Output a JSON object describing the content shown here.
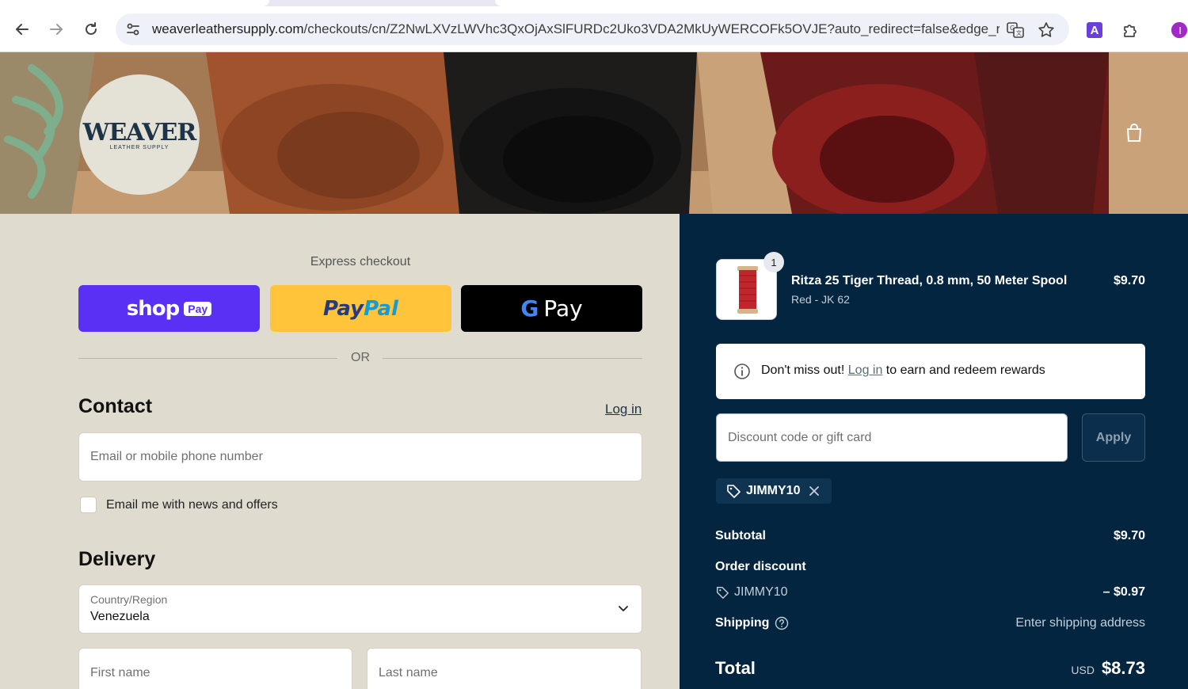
{
  "browser": {
    "url_host": "weaverleathersupply.com",
    "url_path": "/checkouts/cn/Z2NwLXVzLWVhc3QxOjAxSlFURDc2Uko3VDA2MkUyWERCOFk5OVJE?auto_redirect=false&edge_re...",
    "profile_initial": "I",
    "extension_letter": "A"
  },
  "brand": {
    "logo_name": "WEAVER",
    "logo_subtitle": "LEATHER SUPPLY"
  },
  "express": {
    "title": "Express checkout",
    "shop_word": "shop",
    "shop_pill": "Pay",
    "paypal_pay": "Pay",
    "paypal_pal": "Pal",
    "gpay_g": "G",
    "gpay_word": "Pay",
    "or_text": "OR"
  },
  "contact": {
    "heading": "Contact",
    "login_label": "Log in",
    "email_placeholder": "Email or mobile phone number",
    "newsletter_label": "Email me with news and offers"
  },
  "delivery": {
    "heading": "Delivery",
    "country_label": "Country/Region",
    "country_value": "Venezuela",
    "first_name_placeholder": "First name",
    "last_name_placeholder": "Last name"
  },
  "summary": {
    "item": {
      "quantity": "1",
      "title": "Ritza 25 Tiger Thread, 0.8 mm, 50 Meter Spool",
      "variant": "Red - JK 62",
      "price": "$9.70"
    },
    "rewards": {
      "prefix": "Don't miss out! ",
      "link": "Log in",
      "suffix": " to earn and redeem rewards"
    },
    "discount_placeholder": "Discount code or gift card",
    "apply_label": "Apply",
    "applied_code": "JIMMY10",
    "subtotal_label": "Subtotal",
    "subtotal_value": "$9.70",
    "order_discount_label": "Order discount",
    "discount_code": "JIMMY10",
    "discount_value": "– $0.97",
    "shipping_label": "Shipping",
    "shipping_value": "Enter shipping address",
    "total_label": "Total",
    "total_currency": "USD",
    "total_value": "$8.73"
  },
  "colors": {
    "left_bg": "#dfdbcf",
    "summary_bg": "#04253f",
    "shop_purple": "#5a31f4",
    "paypal_yellow": "#ffc439"
  }
}
